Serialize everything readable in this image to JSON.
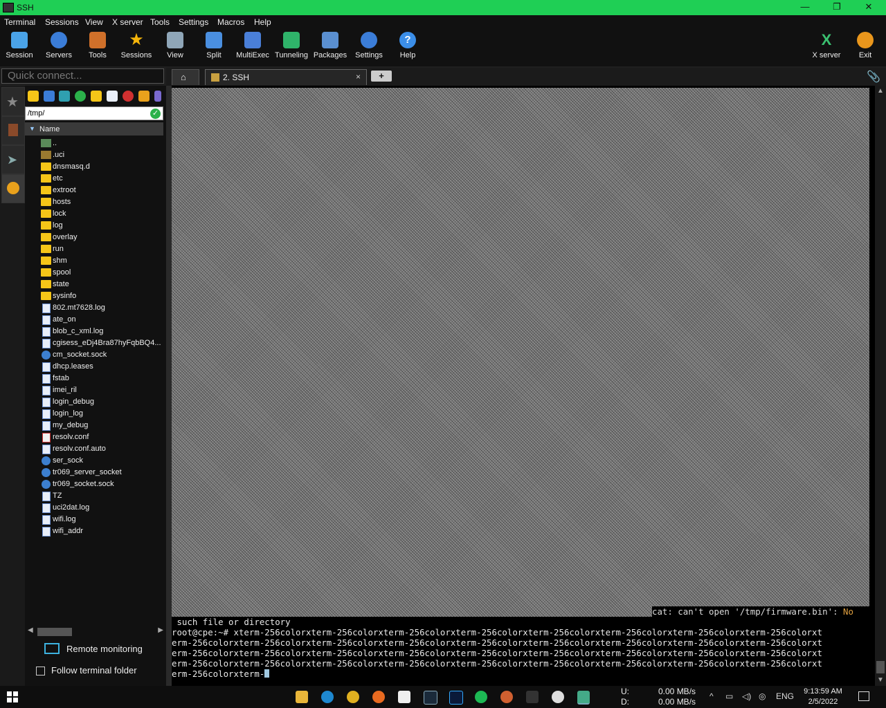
{
  "window": {
    "title": "SSH",
    "min": "—",
    "restore": "❐",
    "close": "✕"
  },
  "menu": [
    "Terminal",
    "Sessions",
    "View",
    "X server",
    "Tools",
    "Settings",
    "Macros",
    "Help"
  ],
  "toolbar": {
    "buttons": [
      {
        "label": "Session",
        "icon": "session-icon",
        "color": "#4aa3e8"
      },
      {
        "label": "Servers",
        "icon": "servers-icon",
        "color": "#3b7dd8"
      },
      {
        "label": "Tools",
        "icon": "tools-icon",
        "color": "#d0702a"
      },
      {
        "label": "Sessions",
        "icon": "star-icon",
        "color": "#f5b50a"
      },
      {
        "label": "View",
        "icon": "view-icon",
        "color": "#8fa6b8"
      },
      {
        "label": "Split",
        "icon": "split-icon",
        "color": "#4a8fe0"
      },
      {
        "label": "MultiExec",
        "icon": "multiexec-icon",
        "color": "#4a7fd8"
      },
      {
        "label": "Tunneling",
        "icon": "tunneling-icon",
        "color": "#2fb36a"
      },
      {
        "label": "Packages",
        "icon": "packages-icon",
        "color": "#5a8fd0"
      },
      {
        "label": "Settings",
        "icon": "settings-icon",
        "color": "#3b7dd8"
      },
      {
        "label": "Help",
        "icon": "help-icon",
        "color": "#3b8ee8"
      }
    ],
    "xserver": "X server",
    "exit": "Exit"
  },
  "quick_connect": {
    "placeholder": "Quick connect..."
  },
  "tabs": {
    "ssh_label": "2. SSH",
    "close": "×",
    "add": "+"
  },
  "sftp": {
    "path": "/tmp/",
    "column": "Name",
    "files": [
      {
        "name": "..",
        "type": "up"
      },
      {
        "name": ".uci",
        "type": "folderdim"
      },
      {
        "name": "dnsmasq.d",
        "type": "folder"
      },
      {
        "name": "etc",
        "type": "folder"
      },
      {
        "name": "extroot",
        "type": "folder"
      },
      {
        "name": "hosts",
        "type": "folder"
      },
      {
        "name": "lock",
        "type": "folder"
      },
      {
        "name": "log",
        "type": "folder"
      },
      {
        "name": "overlay",
        "type": "folder"
      },
      {
        "name": "run",
        "type": "folder"
      },
      {
        "name": "shm",
        "type": "folder"
      },
      {
        "name": "spool",
        "type": "folder"
      },
      {
        "name": "state",
        "type": "folder"
      },
      {
        "name": "sysinfo",
        "type": "folder"
      },
      {
        "name": "802.mt7628.log",
        "type": "file"
      },
      {
        "name": "ate_on",
        "type": "file"
      },
      {
        "name": "blob_c_xml.log",
        "type": "file"
      },
      {
        "name": "cgisess_eDj4Bra87hyFqbBQ4...",
        "type": "file"
      },
      {
        "name": "cm_socket.sock",
        "type": "sock"
      },
      {
        "name": "dhcp.leases",
        "type": "file"
      },
      {
        "name": "fstab",
        "type": "file"
      },
      {
        "name": "imei_ril",
        "type": "file"
      },
      {
        "name": "login_debug",
        "type": "file"
      },
      {
        "name": "login_log",
        "type": "file"
      },
      {
        "name": "my_debug",
        "type": "file"
      },
      {
        "name": "resolv.conf",
        "type": "conf"
      },
      {
        "name": "resolv.conf.auto",
        "type": "file"
      },
      {
        "name": "ser_sock",
        "type": "sock"
      },
      {
        "name": "tr069_server_socket",
        "type": "sock"
      },
      {
        "name": "tr069_socket.sock",
        "type": "sock"
      },
      {
        "name": "TZ",
        "type": "file"
      },
      {
        "name": "uci2dat.log",
        "type": "file"
      },
      {
        "name": "wifi.log",
        "type": "file"
      },
      {
        "name": "wifi_addr",
        "type": "file"
      }
    ],
    "remote_monitoring": "Remote monitoring",
    "follow_terminal": "Follow terminal folder"
  },
  "terminal": {
    "cat_msg": "cat: can't open '/tmp/firmware.bin': ",
    "cat_no": "No",
    "lines": [
      " such file or directory",
      "root@cpe:~# xterm-256colorxterm-256colorxterm-256colorxterm-256colorxterm-256colorxterm-256colorxterm-256colorxterm-256colorxt",
      "erm-256colorxterm-256colorxterm-256colorxterm-256colorxterm-256colorxterm-256colorxterm-256colorxterm-256colorxterm-256colorxt",
      "erm-256colorxterm-256colorxterm-256colorxterm-256colorxterm-256colorxterm-256colorxterm-256colorxterm-256colorxterm-256colorxt",
      "erm-256colorxterm-256colorxterm-256colorxterm-256colorxterm-256colorxterm-256colorxterm-256colorxterm-256colorxterm-256colorxt",
      "erm-256colorxterm-"
    ]
  },
  "taskbar": {
    "upload_label": "U:",
    "download_label": "D:",
    "upload_rate": "0.00 MB/s",
    "download_rate": "0.00 MB/s",
    "lang": "ENG",
    "time": "9:13:59 AM",
    "date": "2/5/2022"
  }
}
